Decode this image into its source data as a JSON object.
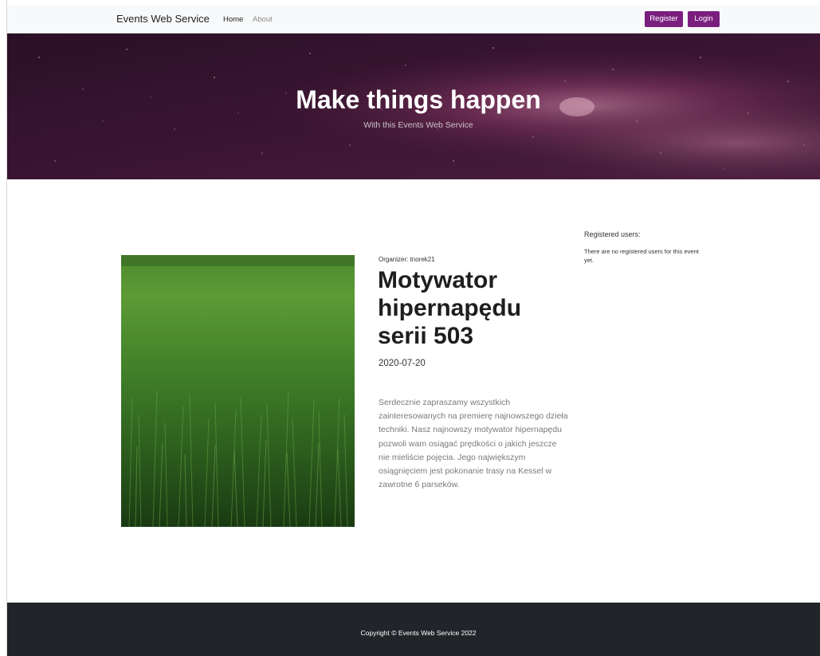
{
  "navbar": {
    "brand": "Events Web Service",
    "links": [
      "Home",
      "About"
    ],
    "register_label": "Register",
    "login_label": "Login",
    "accent_color": "#7b1f7f"
  },
  "hero": {
    "title": "Make things happen",
    "subtitle": "With this Events Web Service"
  },
  "event": {
    "organizer": "Organizer: tnorek21",
    "title": "Motywator hipernapędu serii 503",
    "date": "2020-07-20",
    "description": "Serdecznie zapraszamy wszystkich zainteresowanych na premierę najnowszego dzieła techniki. Nasz najnowszy motywator hipernapędu pozwoli wam osiągać prędkości o jakich jeszcze nie mieliście pojęcia. Jego największym osiągnięciem jest pokonanie trasy na Kessel w zawrotne 6 parseków."
  },
  "registered": {
    "heading": "Registered users:",
    "empty_message": "There are no registered users for this event yet."
  },
  "footer": {
    "copyright": "Copyright © Events Web Service 2022",
    "background_color": "#212529"
  }
}
